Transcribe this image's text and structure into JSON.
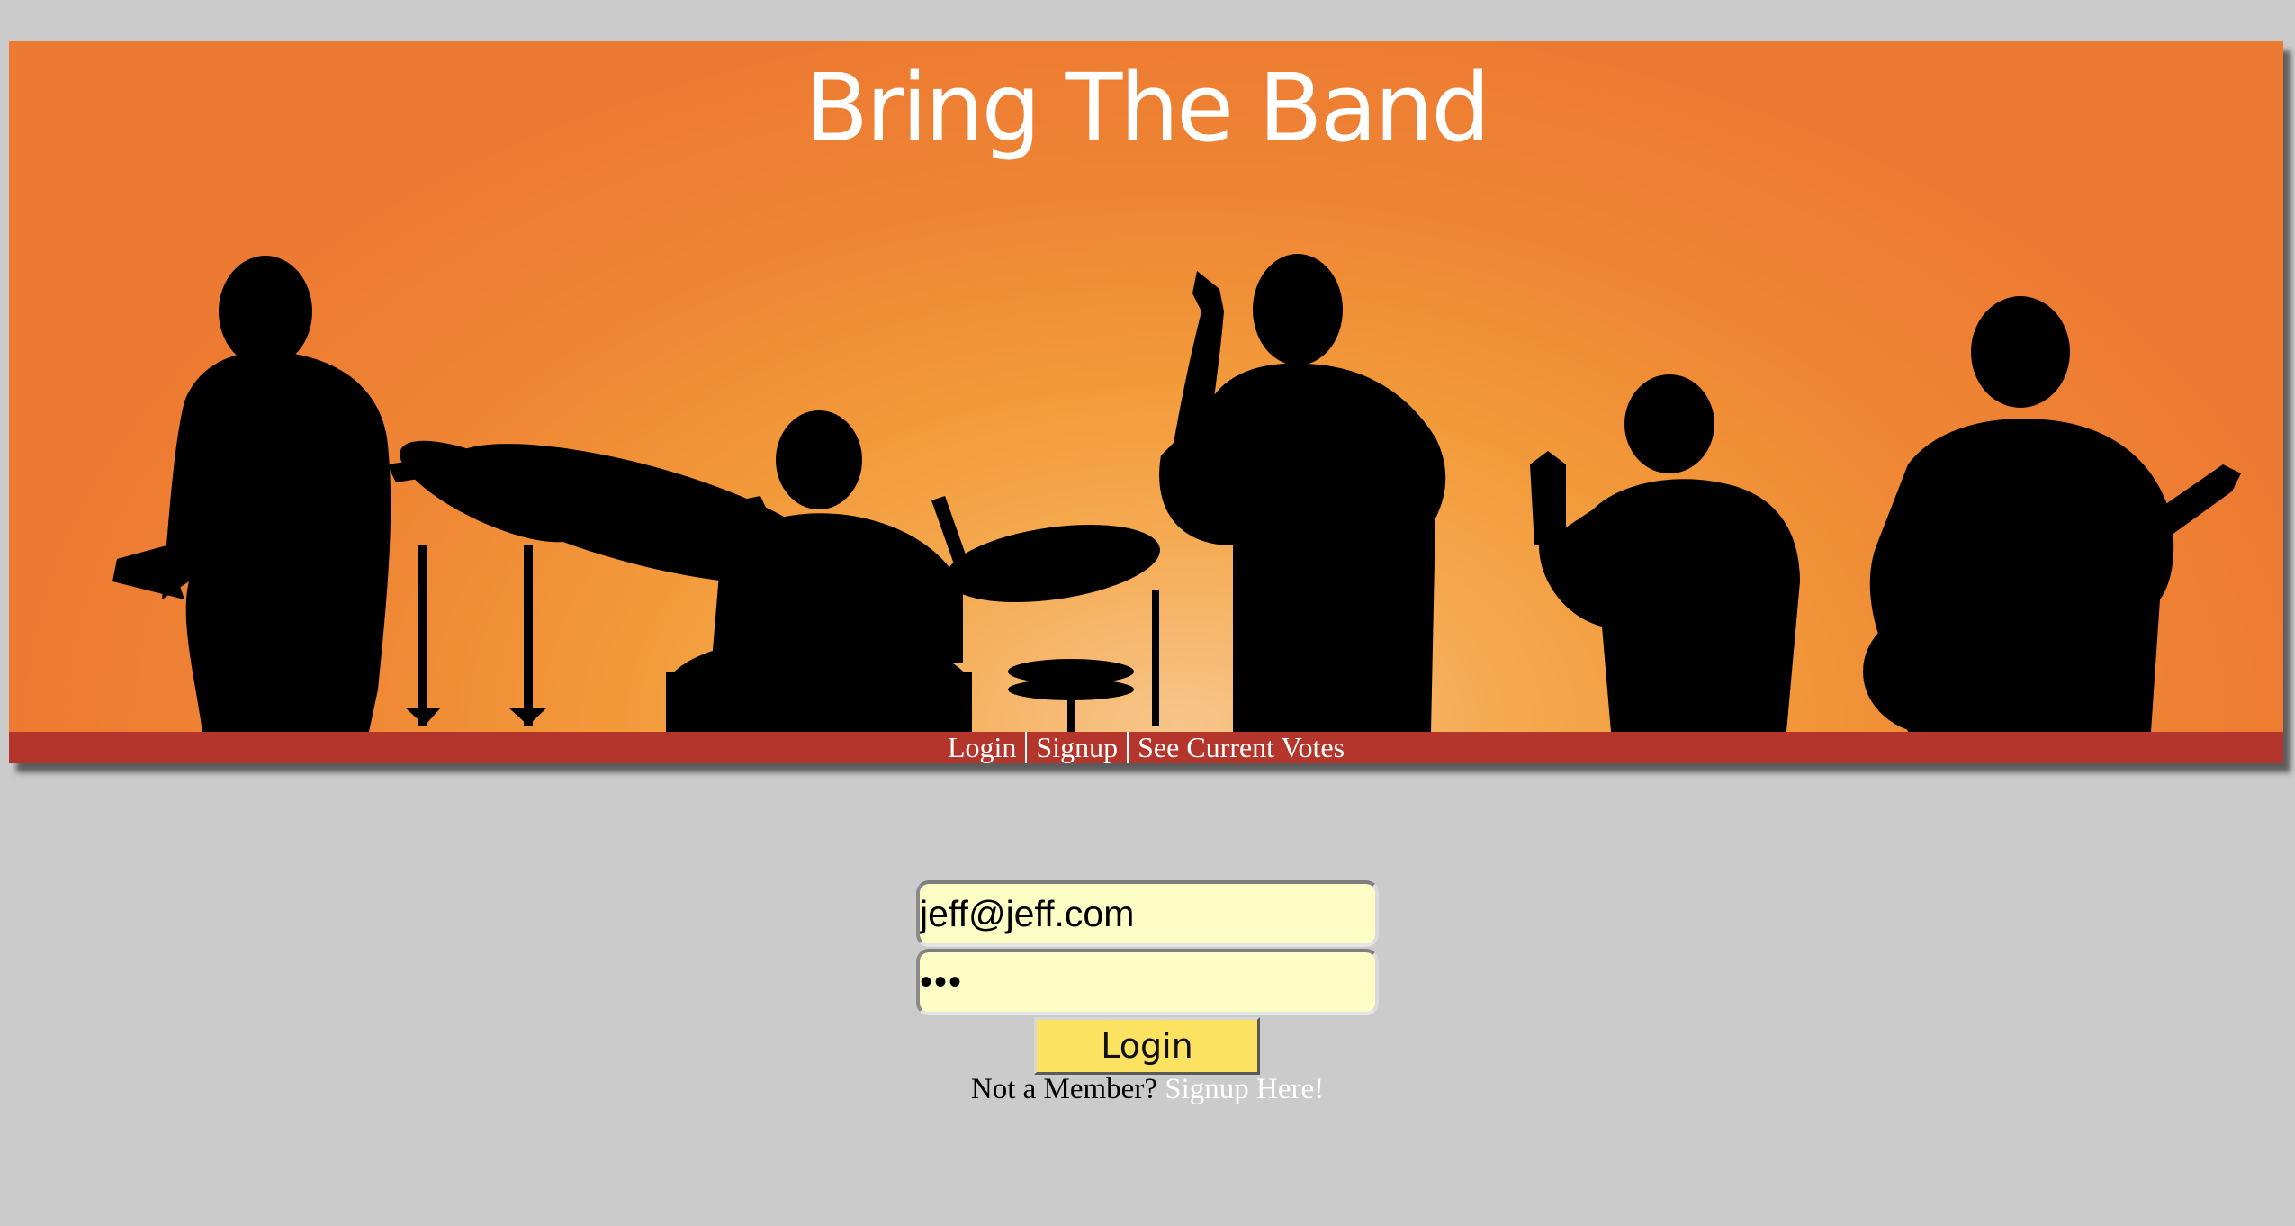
{
  "header": {
    "title": "Bring The Band"
  },
  "nav": {
    "items": [
      {
        "label": "Login"
      },
      {
        "label": "Signup"
      },
      {
        "label": "See Current Votes"
      }
    ]
  },
  "login": {
    "email_value": "jeff@jeff.com",
    "password_mask": "•••",
    "button_label": "Login",
    "not_member_text": "Not a Member?",
    "signup_link_label": "Signup Here!"
  },
  "colors": {
    "page_background": "#cbcbcb",
    "nav_background": "#b3352b",
    "input_background": "#fbfdc4",
    "button_background": "#fbe261",
    "banner_orange": "#ef8634"
  }
}
